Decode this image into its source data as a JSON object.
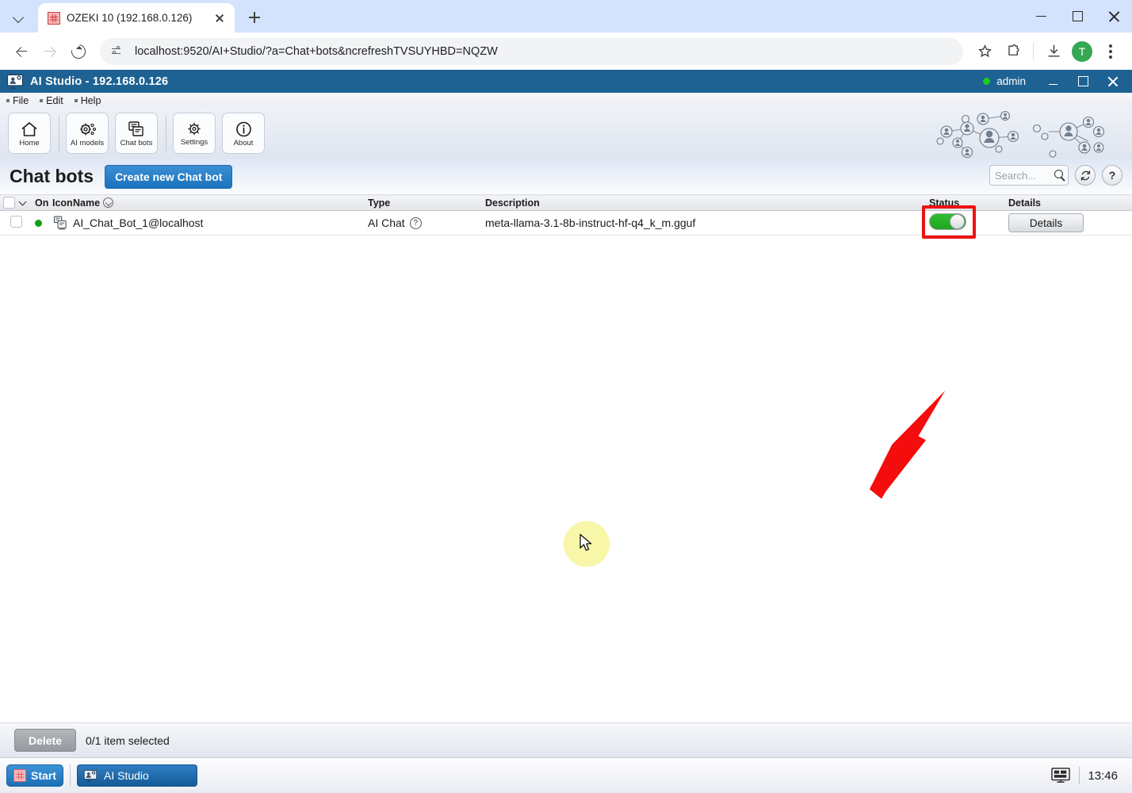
{
  "browser": {
    "tab": {
      "title": "OZEKI 10 (192.168.0.126)",
      "favicon": "ozeki-grid-icon"
    },
    "new_tab_label": "+",
    "url": "localhost:9520/AI+Studio/?a=Chat+bots&ncrefreshTVSUYHBD=NQZW",
    "profile_initial": "T",
    "icons": {
      "back": "back-arrow-icon",
      "forward": "forward-arrow-icon",
      "reload": "reload-icon",
      "site_info": "site-settings-icon",
      "bookmark": "star-icon",
      "extensions": "extensions-puzzle-icon",
      "downloads": "download-icon",
      "menu": "kebab-menu-icon"
    },
    "window_controls": {
      "minimize": "minimize-icon",
      "maximize": "maximize-icon",
      "close": "close-icon"
    }
  },
  "app": {
    "title": "AI Studio - 192.168.0.126",
    "user": "admin",
    "user_status_color": "#1ecb1e",
    "titlebar_color": "#1d6293",
    "menu": [
      {
        "label": "File"
      },
      {
        "label": "Edit"
      },
      {
        "label": "Help"
      }
    ],
    "ribbon": [
      {
        "label": "Home",
        "icon": "home-icon"
      },
      {
        "label": "AI models",
        "icon": "ai-models-gear-icon"
      },
      {
        "label": "Chat bots",
        "icon": "chat-bots-icon"
      },
      {
        "label": "Settings",
        "icon": "gear-icon"
      },
      {
        "label": "About",
        "icon": "info-icon"
      }
    ]
  },
  "page": {
    "title": "Chat bots",
    "create_button": "Create new Chat bot",
    "search_placeholder": "Search...",
    "refresh_icon": "refresh-icon",
    "help_icon": "help-question-icon",
    "table": {
      "columns": [
        "On",
        "Icon",
        "Name",
        "Type",
        "Description",
        "Status",
        "Details"
      ],
      "header_on": "On",
      "header_icon": "Icon",
      "header_name": "Name",
      "header_type": "Type",
      "header_description": "Description",
      "header_status": "Status",
      "header_details": "Details",
      "rows": [
        {
          "selected": false,
          "online": true,
          "name": "AI_Chat_Bot_1@localhost",
          "type": "AI Chat",
          "description": "meta-llama-3.1-8b-instruct-hf-q4_k_m.gguf",
          "status_on": true,
          "details_label": "Details"
        }
      ]
    }
  },
  "footer": {
    "delete_label": "Delete",
    "selection_text": "0/1 item selected"
  },
  "taskbar": {
    "start_label": "Start",
    "items": [
      {
        "label": "AI Studio",
        "icon": "ai-studio-icon"
      }
    ],
    "tray_icon": "display-monitor-icon",
    "clock": "13:46"
  },
  "annotations": {
    "highlight_color": "#ee1111",
    "highlight_target": "status-toggle",
    "arrow": "red-arrow-pointing-to-status-toggle",
    "cursor_highlight_color": "#f7f49a"
  }
}
